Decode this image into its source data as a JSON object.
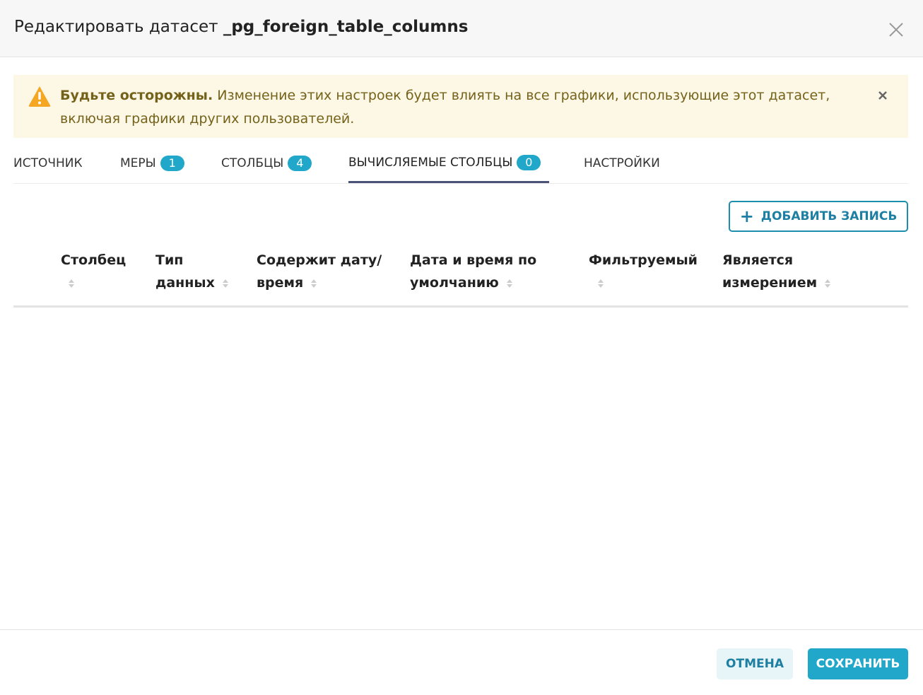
{
  "modal": {
    "title_prefix": "Редактировать датасет",
    "dataset_name": "_pg_foreign_table_columns"
  },
  "alert": {
    "strong": "Будьте осторожны.",
    "message": "Изменение этих настроек будет влиять на все графики, использующие этот датасет, включая графики других пользователей."
  },
  "tabs": [
    {
      "label": "ИСТОЧНИК",
      "badge": ""
    },
    {
      "label": "МЕРЫ",
      "badge": "1"
    },
    {
      "label": "СТОЛБЦЫ",
      "badge": "4"
    },
    {
      "label": "ВЫЧИСЛЯЕМЫЕ СТОЛБЦЫ",
      "badge": "0"
    },
    {
      "label": "НАСТРОЙКИ",
      "badge": ""
    }
  ],
  "active_tab": "ВЫЧИСЛЯЕМЫЕ СТОЛБЦЫ",
  "toolbar": {
    "add_label": "ДОБАВИТЬ ЗАПИСЬ"
  },
  "table": {
    "columns": [
      {
        "line1": "Столбец",
        "line2": ""
      },
      {
        "line1": "Тип",
        "line2": "данных"
      },
      {
        "line1": "Содержит дату/",
        "line2": "время"
      },
      {
        "line1": "Дата и время по",
        "line2": "умолчанию"
      },
      {
        "line1": "Фильтруемый",
        "line2": ""
      },
      {
        "line1": "Является",
        "line2": "измерением"
      }
    ],
    "rows": []
  },
  "footer": {
    "cancel_label": "ОТМЕНА",
    "save_label": "СОХРАНИТЬ"
  },
  "colors": {
    "accent": "#20a7c9",
    "alert_bg": "#fdf7e5",
    "alert_text": "#75621a",
    "active_tab_underline": "#4b5278",
    "warning_icon": "#f5a623"
  },
  "icons": [
    "close-icon",
    "warning-icon",
    "plus-icon",
    "sort-icon"
  ]
}
